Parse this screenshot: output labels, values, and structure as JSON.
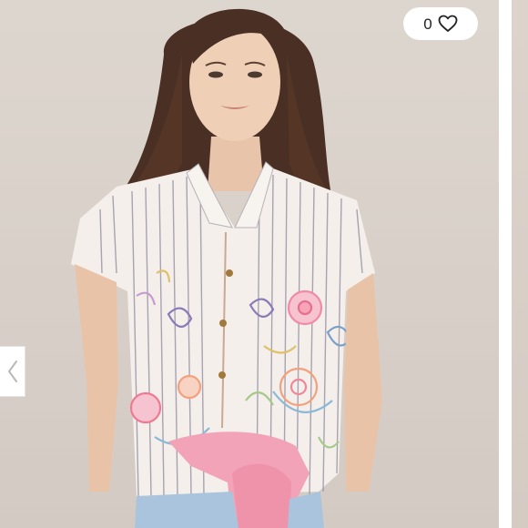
{
  "listing": {
    "like_count": "0",
    "like_icon": "heart-outline-icon",
    "prev_icon": "chevron-left-icon"
  },
  "colors": {
    "background": "#d8d0c8",
    "accent_pink": "#f2a3b8",
    "denim": "#a9c4dc"
  }
}
